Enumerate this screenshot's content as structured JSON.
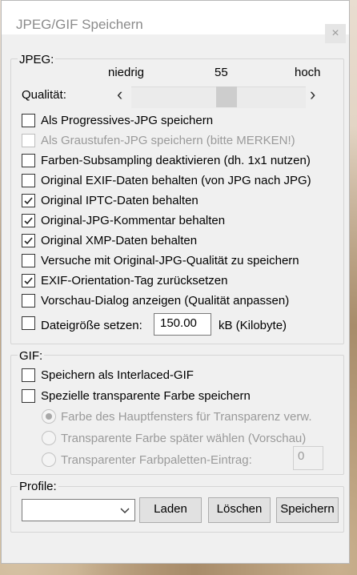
{
  "window": {
    "title": "JPEG/GIF Speichern",
    "close_glyph": "×"
  },
  "jpeg": {
    "group_label": "JPEG:",
    "quality_label": "Qualität:",
    "scale_low": "niedrig",
    "scale_value": "55",
    "scale_high": "hoch",
    "quality_value": 55,
    "left_arrow": "‹",
    "right_arrow": "›",
    "options": [
      {
        "label": "Als Progressives-JPG speichern",
        "checked": false,
        "disabled": false
      },
      {
        "label": "Als Graustufen-JPG speichern (bitte MERKEN!)",
        "checked": false,
        "disabled": true
      },
      {
        "label": "Farben-Subsampling deaktivieren (dh. 1x1 nutzen)",
        "checked": false,
        "disabled": false
      },
      {
        "label": "Original EXIF-Daten behalten (von JPG nach JPG)",
        "checked": false,
        "disabled": false
      },
      {
        "label": "Original IPTC-Daten behalten",
        "checked": true,
        "disabled": false
      },
      {
        "label": "Original-JPG-Kommentar behalten",
        "checked": true,
        "disabled": false
      },
      {
        "label": "Original XMP-Daten behalten",
        "checked": true,
        "disabled": false
      },
      {
        "label": "Versuche mit Original-JPG-Qualität zu speichern",
        "checked": false,
        "disabled": false
      },
      {
        "label": "EXIF-Orientation-Tag zurücksetzen",
        "checked": true,
        "disabled": false
      },
      {
        "label": "Vorschau-Dialog anzeigen (Qualität anpassen)",
        "checked": false,
        "disabled": false
      }
    ],
    "filesize_label": "Dateigröße setzen:",
    "filesize_value": "150.00",
    "filesize_unit": "kB (Kilobyte)"
  },
  "gif": {
    "group_label": "GIF:",
    "options": [
      {
        "label": "Speichern als Interlaced-GIF",
        "checked": false
      },
      {
        "label": "Spezielle transparente Farbe speichern",
        "checked": false
      }
    ],
    "radios": [
      {
        "label": "Farbe des Hauptfensters für Transparenz verw.",
        "selected": true
      },
      {
        "label": "Transparente Farbe später wählen (Vorschau)",
        "selected": false
      },
      {
        "label": "Transparenter Farbpaletten-Eintrag:",
        "selected": false
      }
    ],
    "palette_index": "0"
  },
  "profile": {
    "group_label": "Profile:",
    "selected": "",
    "load_label": "Laden",
    "delete_label": "Löschen",
    "save_label": "Speichern"
  }
}
